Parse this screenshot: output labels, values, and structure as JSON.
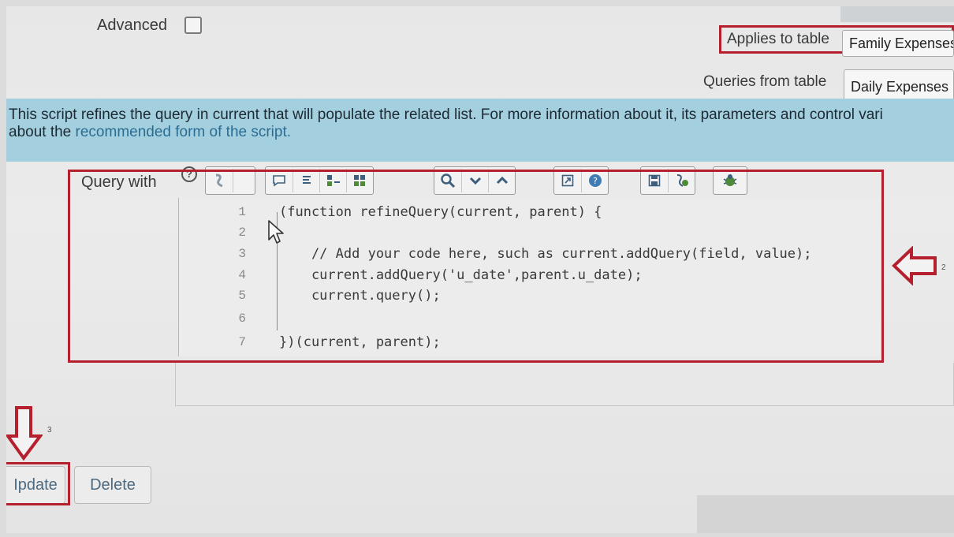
{
  "form": {
    "advanced_label": "Advanced",
    "applies_to_label": "Applies to table",
    "applies_to_value": "Family Expenses",
    "queries_from_label": "Queries from table",
    "queries_from_value": "Daily Expenses ["
  },
  "info": {
    "line1": "This script refines the query in current that will populate the related list. For more information about it, its parameters and control vari",
    "line2_prefix": "about the ",
    "line2_link": "recommended form of the script."
  },
  "query_with": {
    "label": "Query with",
    "help_glyph": "?",
    "toolbar_icons": [
      "script-include-icon",
      "comment-icon",
      "format-icon",
      "replace-icon",
      "replace-all-icon",
      "search-icon",
      "chevron-down-icon",
      "chevron-up-icon",
      "fullscreen-icon",
      "help-icon",
      "save-icon",
      "script-debug-icon",
      "bug-icon"
    ],
    "lines": [
      {
        "n": "1",
        "code": "(function refineQuery(current, parent) {"
      },
      {
        "n": "2",
        "code": ""
      },
      {
        "n": "3",
        "code": "    // Add your code here, such as current.addQuery(field, value);"
      },
      {
        "n": "4",
        "code": "    current.addQuery('u_date',parent.u_date);"
      },
      {
        "n": "5",
        "code": "    current.query();"
      },
      {
        "n": "6",
        "code": ""
      },
      {
        "n": "7",
        "code": "})(current, parent);"
      }
    ]
  },
  "annotations": {
    "arrow_right_num": "2",
    "arrow_down_num": "3"
  },
  "buttons": {
    "update": "Ipdate",
    "delete": "Delete"
  },
  "colors": {
    "highlight": "#b51f2e",
    "info_bar": "#a4cfde",
    "link": "#2b6d92"
  }
}
